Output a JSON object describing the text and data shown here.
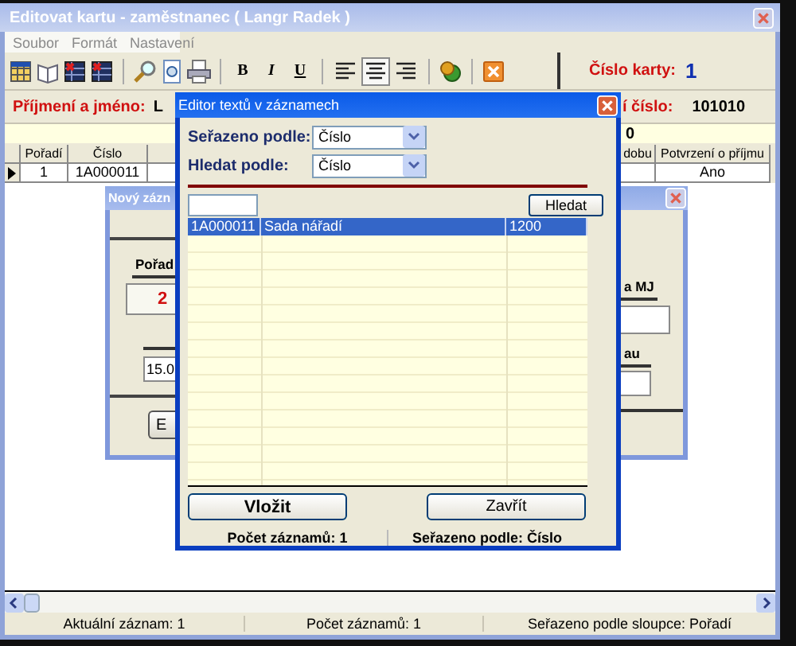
{
  "main_window": {
    "title": "Editovat kartu - zaměstnanec ( Langr Radek )",
    "menu": [
      "Soubor",
      "Formát",
      "Nastavení"
    ],
    "toolbar": {
      "format_buttons": [
        "B",
        "I",
        "U"
      ],
      "align_buttons": [
        {
          "selected": false
        },
        {
          "selected": true
        },
        {
          "selected": false
        }
      ]
    },
    "card_number": {
      "label": "Číslo karty:",
      "value": "1"
    },
    "name": {
      "label": "Příjmení a jméno:",
      "value": "L"
    },
    "personal_number": {
      "label": "í číslo:",
      "value": "101010"
    },
    "highlight_field": {
      "value": "0"
    },
    "table": {
      "columns": [
        "Pořadí",
        "Číslo",
        "dobu",
        "Potvrzení o příjmu"
      ],
      "rows": [
        {
          "current": true,
          "cells": [
            "1",
            "1A000011",
            "",
            "Ano"
          ]
        }
      ]
    },
    "status_bar": [
      "Aktuální záznam: 1",
      "Počet záznamů: 1",
      "Seřazeno podle sloupce: Pořadí"
    ]
  },
  "new_record_dialog": {
    "title": "Nový zázn",
    "fields": [
      {
        "label": "Pořad",
        "value": "2"
      },
      {
        "value": "15.0"
      },
      {
        "label": "a MJ"
      },
      {
        "label": "au"
      }
    ],
    "button": "E"
  },
  "text_editor": {
    "title": "Editor textů v záznamech",
    "sort_by": {
      "label": "Seřazeno podle:",
      "value": "Číslo"
    },
    "search_by": {
      "label": "Hledat podle:",
      "value": "Číslo"
    },
    "search_button": "Hledat",
    "rows": [
      {
        "selected": true,
        "cells": [
          "1A000011",
          "Sada nářadí",
          "1200"
        ]
      }
    ],
    "buttons": [
      {
        "label": "Vložit",
        "default": true
      },
      {
        "label": "Zavřít",
        "default": false
      }
    ],
    "footer": [
      "Počet záznamů: 1",
      "Seřazeno podle: Číslo"
    ]
  }
}
